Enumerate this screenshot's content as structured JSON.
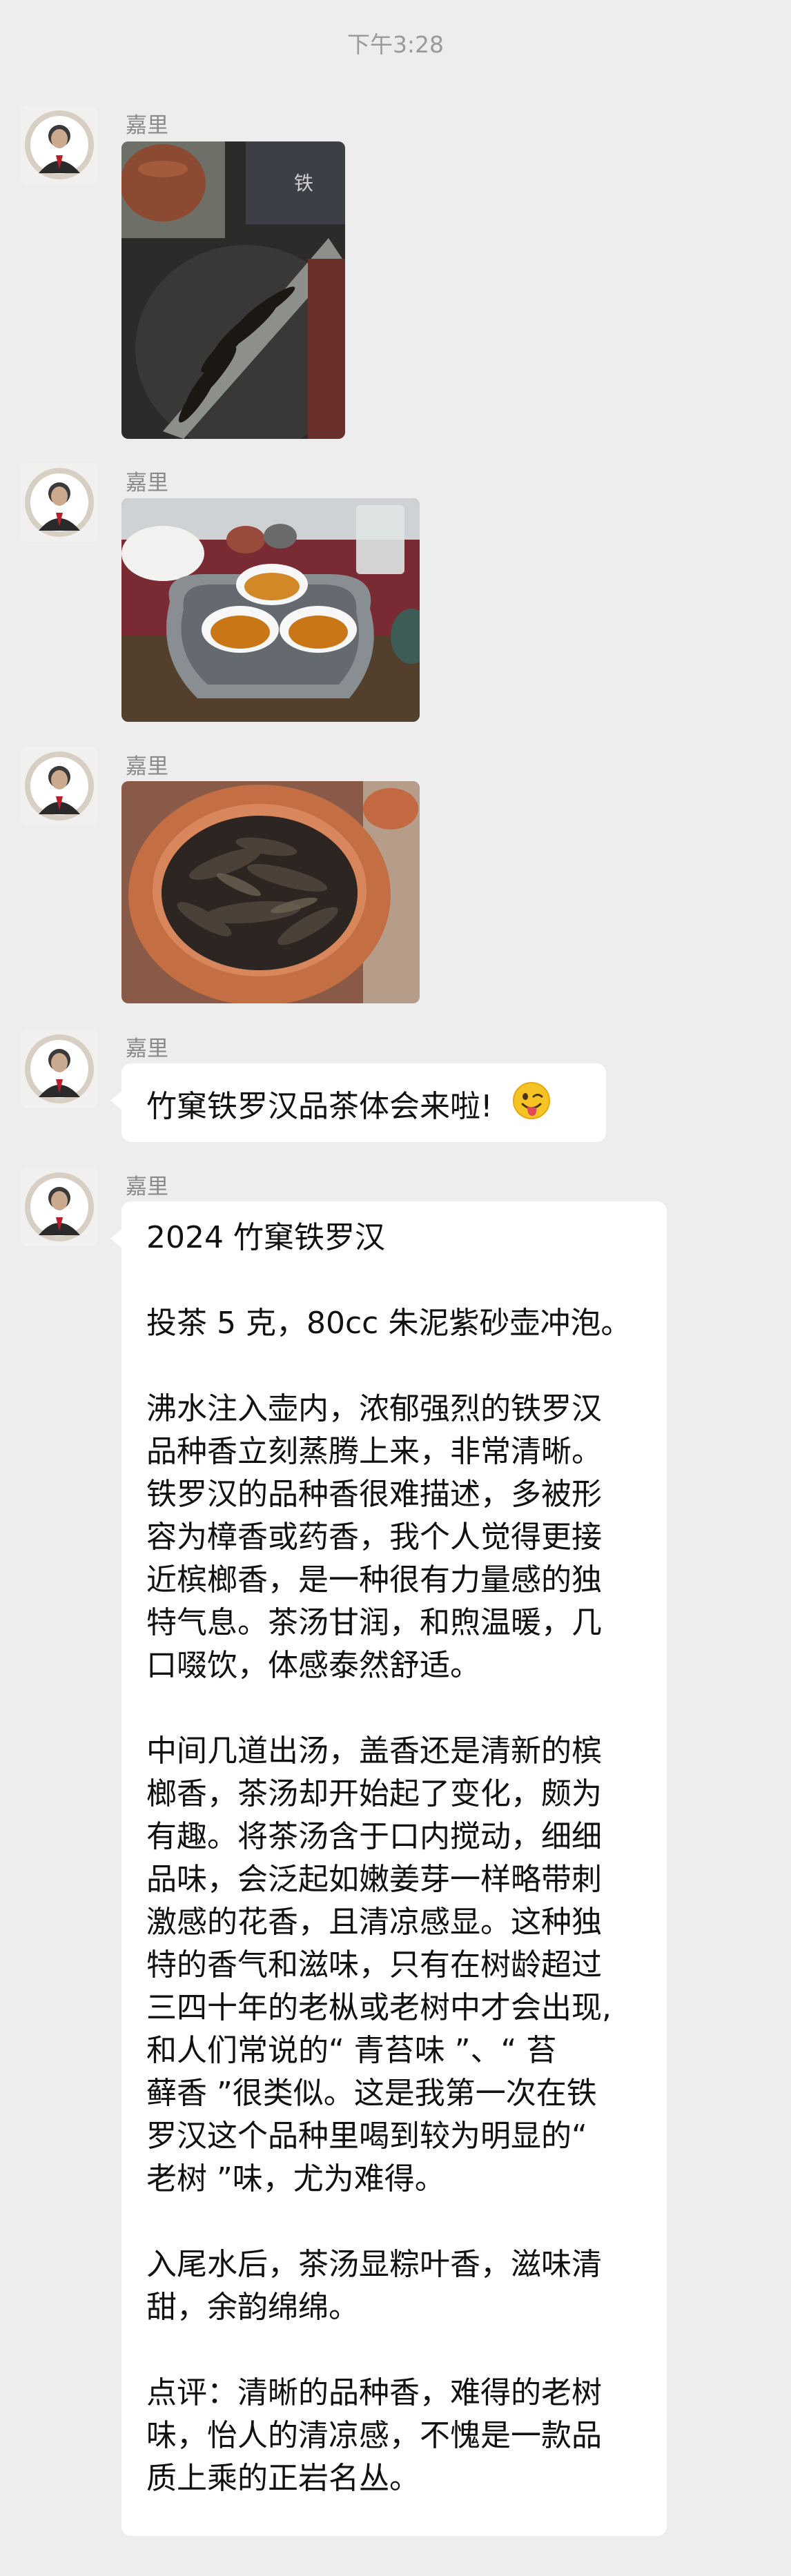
{
  "chat": {
    "timestamp": "下午3:28",
    "sender_name": "嘉里"
  },
  "images": [
    {
      "name": "tea-leaves-tray-photo",
      "desc_icon": "photo-icon"
    },
    {
      "name": "tea-cups-photo",
      "desc_icon": "photo-icon"
    },
    {
      "name": "tea-pot-leaves-photo",
      "desc_icon": "photo-icon"
    }
  ],
  "messages": {
    "announce": {
      "text": "竹窠铁罗汉品茶体会来啦!",
      "emoji": "winking-face-tongue-icon"
    },
    "review": {
      "paragraphs": [
        "2024 竹窠铁罗汉",
        "投茶 5 克，80cc 朱泥紫砂壶冲泡。",
        "沸水注入壶内，浓郁强烈的铁罗汉\n品种香立刻蒸腾上来，非常清晰。\n铁罗汉的品种香很难描述，多被形\n容为樟香或药香，我个人觉得更接\n近槟榔香，是一种很有力量感的独\n特气息。茶汤甘润，和煦温暖，几\n口啜饮，体感泰然舒适。",
        "中间几道出汤，盖香还是清新的槟\n榔香，茶汤却开始起了变化，颇为\n有趣。将茶汤含于口内搅动，细细\n品味，会泛起如嫩姜芽一样略带刺\n激感的花香，且清凉感显。这种独\n特的香气和滋味，只有在树龄超过\n三四十年的老枞或老树中才会出现,\n和人们常说的“ 青苔味 ”、“ 苔\n藓香 ”很类似。这是我第一次在铁\n罗汉这个品种里喝到较为明显的“\n老树 ”味，尤为难得。",
        "入尾水后，茶汤显粽叶香，滋味清\n甜，余韵绵绵。",
        "点评：清晰的品种香，难得的老树\n味，怡人的清凉感，不愧是一款品\n质上乘的正岩名丛。"
      ]
    }
  },
  "colors": {
    "background": "#ededed",
    "bubble": "#ffffff",
    "name_text": "#8a8a8a",
    "message_text": "#111111"
  }
}
